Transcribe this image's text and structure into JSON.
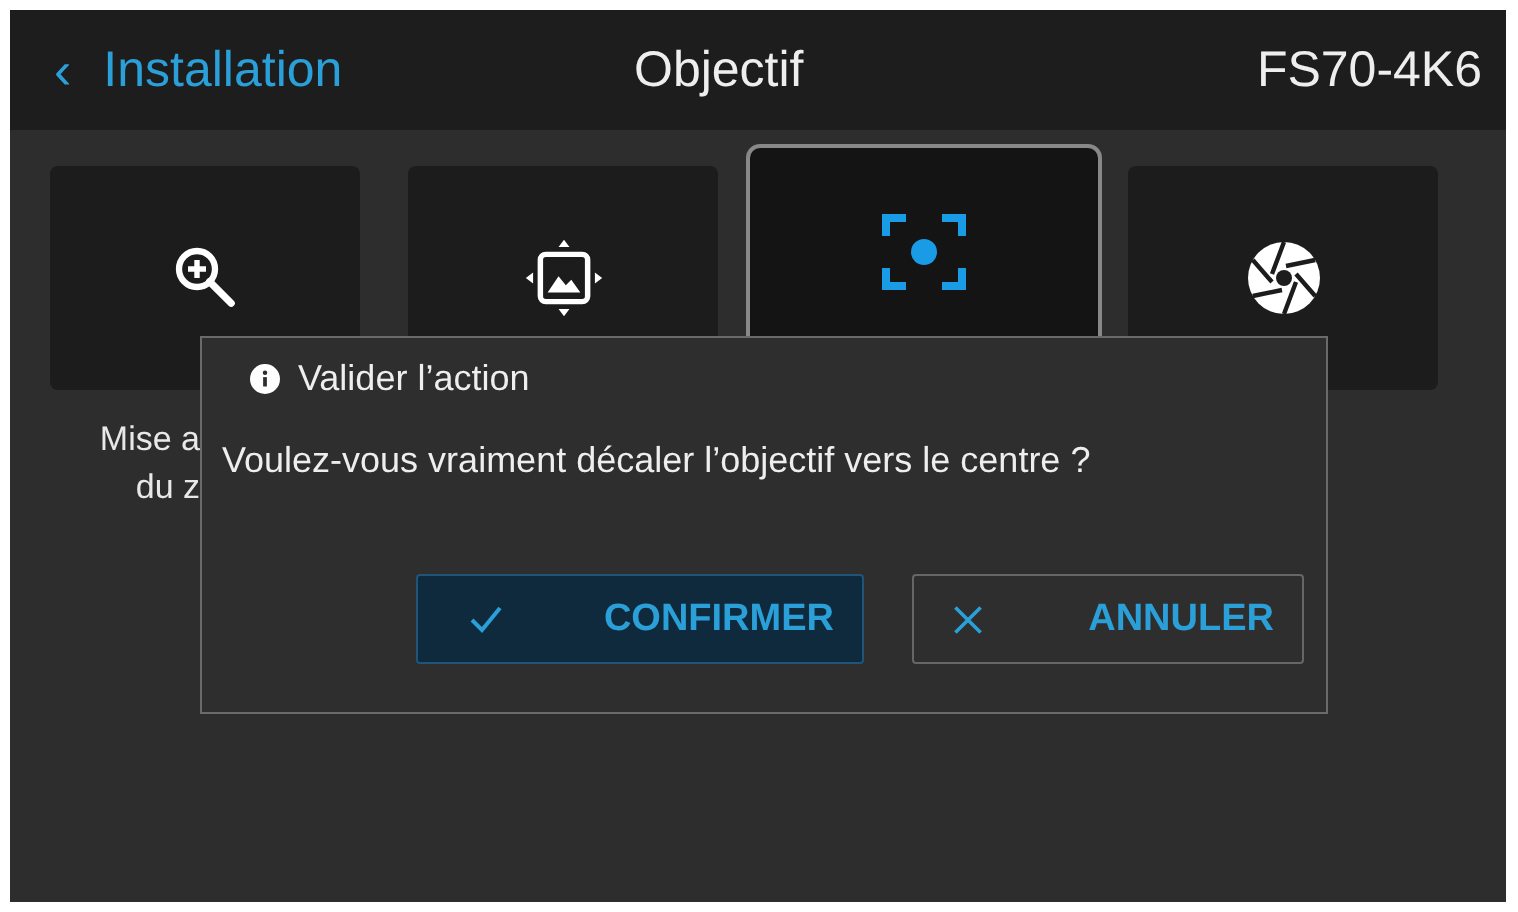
{
  "header": {
    "back": {
      "arrow": "‹",
      "label": "Installation"
    },
    "title": "Objectif",
    "device": "FS70-4K6"
  },
  "tiles": [
    {
      "kind": "zoom",
      "selected": false,
      "label_lines": [
        "Mise a",
        "du z"
      ]
    },
    {
      "kind": "shift",
      "selected": false
    },
    {
      "kind": "center",
      "selected": true
    },
    {
      "kind": "iris",
      "selected": false
    }
  ],
  "dialog": {
    "title": "Valider l’action",
    "message": "Voulez-vous vraiment décaler l’objectif vers le centre ?",
    "buttons": [
      {
        "kind": "confirm",
        "label": "CONFIRMER",
        "selected": true
      },
      {
        "kind": "cancel",
        "label": "ANNULER",
        "selected": false
      }
    ]
  }
}
